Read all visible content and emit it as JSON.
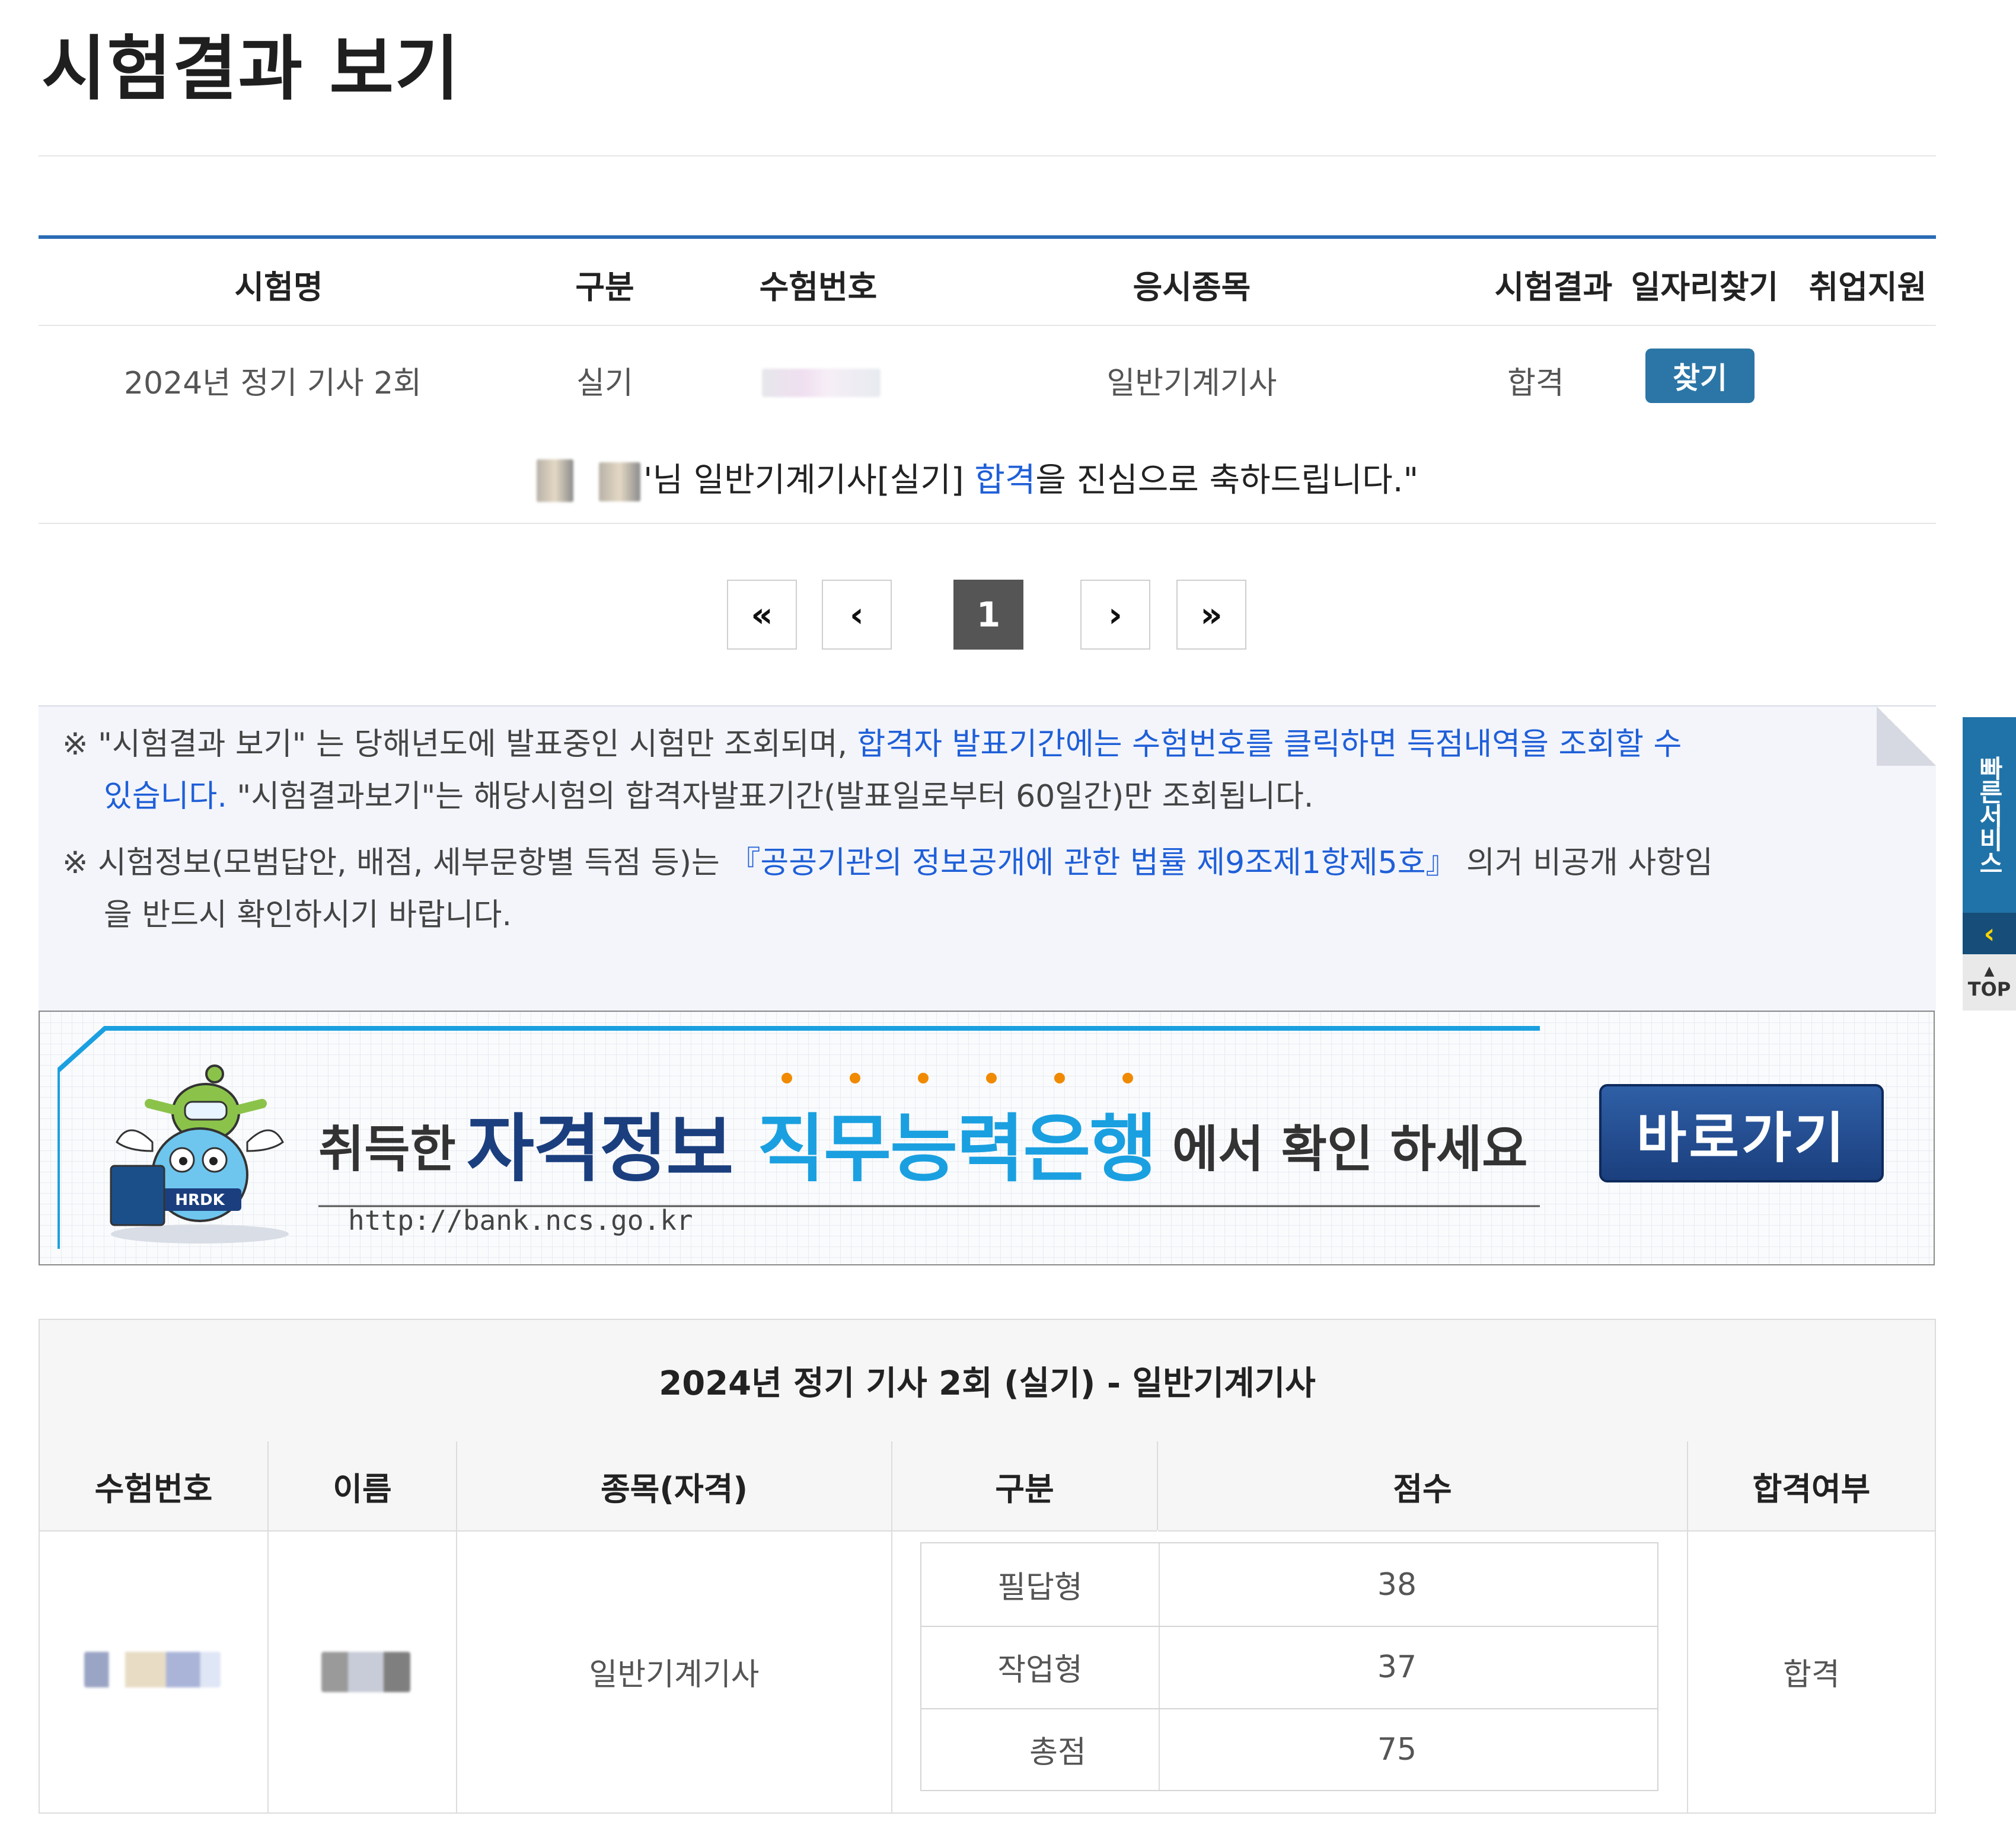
{
  "page": {
    "title": "시험결과 보기"
  },
  "results": {
    "headers": [
      "시험명",
      "구분",
      "수험번호",
      "응시종목",
      "시험결과",
      "일자리찾기",
      "취업지원"
    ],
    "row": {
      "exam_name": "2024년 정기 기사 2회",
      "category": "실기",
      "subject": "일반기계기사",
      "result": "합격",
      "find_label": "찾기"
    },
    "congrats": {
      "prefix": "'님 일반기계기사[실기] ",
      "highlight": "합격",
      "suffix": "을 진심으로 축하드립니다.\""
    }
  },
  "pagination": {
    "first": "«",
    "prev": "‹",
    "current": "1",
    "next": "›",
    "last": "»"
  },
  "notice": {
    "n1_mark": "※",
    "n1_a": "\"시험결과 보기\" 는 당해년도에 발표중인 시험만 조회되며, ",
    "n1_blue": "합격자 발표기간에는 수험번호를 클릭하면 득점내역을 조회할 수",
    "n1_blue2": "있습니다.",
    "n1_b": " \"시험결과보기\"는 해당시험의 합격자발표기간(발표일로부터 60일간)만 조회됩니다.",
    "n2_mark": "※",
    "n2_a": "시험정보(모범답안, 배점, 세부문항별 득점 등)는 ",
    "n2_blue": "『공공기관의 정보공개에 관한 법률 제9조제1항제5호』",
    "n2_b": " 의거 비공개 사항임",
    "n2_c": "을 반드시 확인하시기 바랍니다."
  },
  "banner": {
    "prefix": "취득한",
    "word1": "자격정보",
    "word2": "직무능력은행",
    "suffix": "에서 확인 하세요",
    "url": "http://bank.ncs.go.kr",
    "button": "바로가기",
    "mascot_text": "HRDK",
    "colors": {
      "navy": "#1b3f7e",
      "cyan": "#1aa0e0",
      "orange": "#f08a00"
    }
  },
  "side": {
    "label": "빠른서비스",
    "arrow": "‹",
    "top_label": "TOP"
  },
  "detail": {
    "title": "2024년 정기 기사 2회 (실기) - 일반기계기사",
    "headers": [
      "수험번호",
      "이름",
      "종목(자격)",
      "구분",
      "점수",
      "합격여부"
    ],
    "subject": "일반기계기사",
    "pass_status": "합격",
    "scores": [
      {
        "type": "필답형",
        "score": "38"
      },
      {
        "type": "작업형",
        "score": "37"
      },
      {
        "type": "총점",
        "score": "75"
      }
    ]
  },
  "colors": {
    "primary_blue": "#2a6cb5",
    "link_blue": "#1f5fd8",
    "button_teal": "#2b76a6"
  }
}
